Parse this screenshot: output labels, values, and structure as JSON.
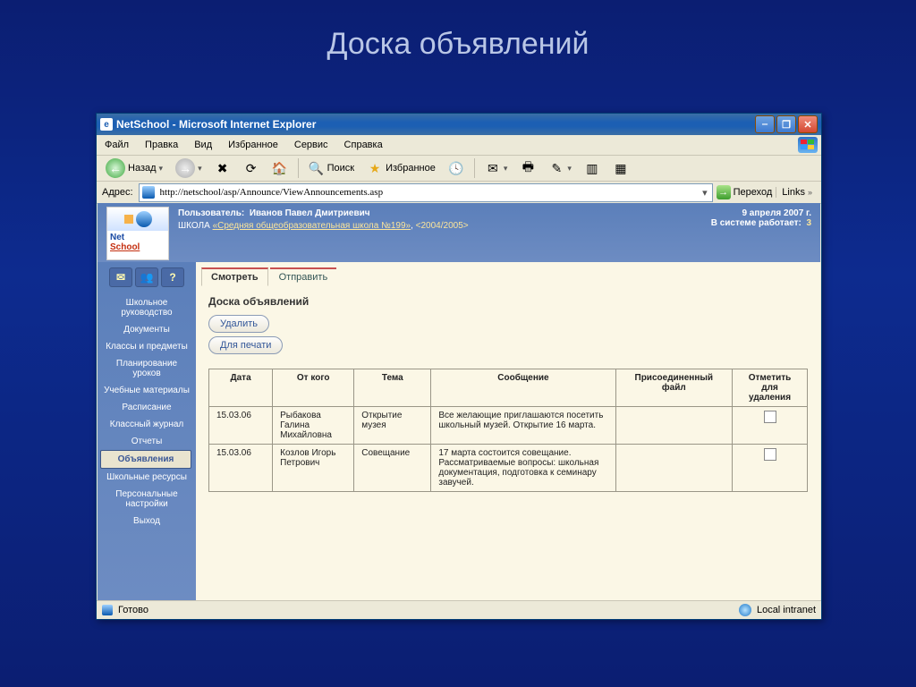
{
  "slide": {
    "title": "Доска объявлений"
  },
  "window": {
    "app_title": "NetSchool - Microsoft Internet Explorer",
    "menus": {
      "file": "Файл",
      "edit": "Правка",
      "view": "Вид",
      "fav": "Избранное",
      "tools": "Сервис",
      "help": "Справка"
    },
    "back": "Назад",
    "search": "Поиск",
    "favorites": "Избранное",
    "address_label": "Адрес:",
    "url": "http://netschool/asp/Announce/ViewAnnouncements.asp",
    "go": "Переход",
    "links": "Links"
  },
  "pagehead": {
    "user_label": "Пользователь:",
    "user_name": "Иванов Павел Дмитриевич",
    "school_prefix": "ШКОЛА",
    "school_link": "«Средняя общеобразовательная школа №199»",
    "year": "<2004/2005>",
    "date": "9 апреля 2007 г.",
    "sys1": "В системе работает:",
    "sys_n": "3",
    "logo_top": "Net",
    "logo_bot": "School"
  },
  "sidebar": {
    "icons": {
      "envelope": "✉",
      "user": "👥",
      "help": "?"
    },
    "items": [
      {
        "label": "Школьное руководство"
      },
      {
        "label": "Документы"
      },
      {
        "label": "Классы и предметы"
      },
      {
        "label": "Планирование уроков"
      },
      {
        "label": "Учебные материалы"
      },
      {
        "label": "Расписание"
      },
      {
        "label": "Классный журнал"
      },
      {
        "label": "Отчеты"
      },
      {
        "label": "Объявления",
        "active": true
      },
      {
        "label": "Школьные ресурсы"
      },
      {
        "label": "Персональные настройки"
      },
      {
        "label": "Выход"
      }
    ]
  },
  "main": {
    "tabs": {
      "view": "Смотреть",
      "send": "Отправить"
    },
    "heading": "Доска объявлений",
    "btn_delete": "Удалить",
    "btn_print": "Для печати",
    "headers": {
      "date": "Дата",
      "from": "От кого",
      "subject": "Тема",
      "message": "Сообщение",
      "file": "Присоединенный файл",
      "mark": "Отметить для удаления"
    },
    "rows": [
      {
        "date": "15.03.06",
        "from": "Рыбакова Галина Михайловна",
        "subject": "Открытие музея",
        "message": "Все желающие приглашаются посетить школьный музей. Открытие 16 марта.",
        "file": ""
      },
      {
        "date": "15.03.06",
        "from": "Козлов Игорь Петрович",
        "subject": "Совещание",
        "message": "17 марта состоится совещание. Рассматриваемые вопросы: школьная документация, подготовка к семинару завучей.",
        "file": ""
      }
    ]
  },
  "status": {
    "ready": "Готово",
    "zone": "Local intranet"
  }
}
